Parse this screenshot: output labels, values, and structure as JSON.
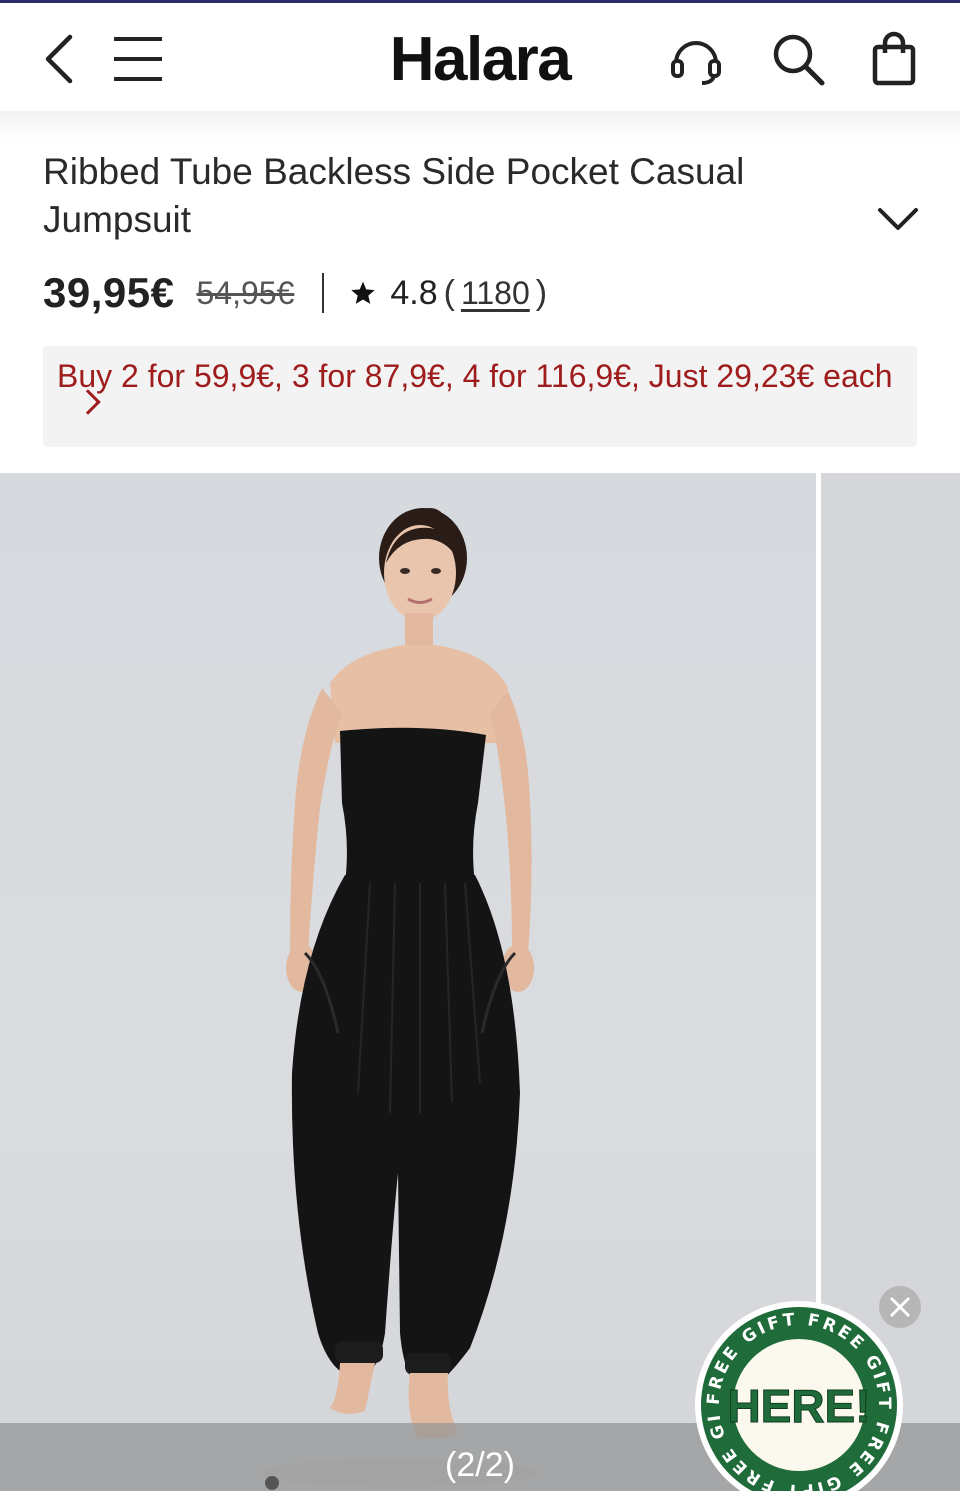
{
  "header": {
    "brand": "Halara",
    "icons": [
      "back-icon",
      "menu-icon",
      "headset-icon",
      "search-icon",
      "shopping-bag-icon"
    ]
  },
  "product": {
    "title": "Ribbed Tube Backless Side Pocket Casual Jumpsuit",
    "price": "39,95€",
    "original_price": "54,95€",
    "rating": "4.8",
    "paren_open": "(",
    "paren_close": ")",
    "review_count": "1180",
    "promo": "Buy 2 for 59,9€, 3 for 87,9€, 4 for 116,9€, Just 29,23€ each"
  },
  "gallery": {
    "counter": "(2/2)",
    "dots": 1,
    "garment_color": "#141414",
    "background_color": "#d9dbdf"
  },
  "gift_badge": {
    "ring_text": "FREE GIFT FREE GIFT FREE GIFT FREE GIFT",
    "center_text": "HERE!",
    "ring_color": "#1f6b3a"
  },
  "colors": {
    "promo_text": "#9e1c1c",
    "promo_bg": "#f3f3f3"
  }
}
